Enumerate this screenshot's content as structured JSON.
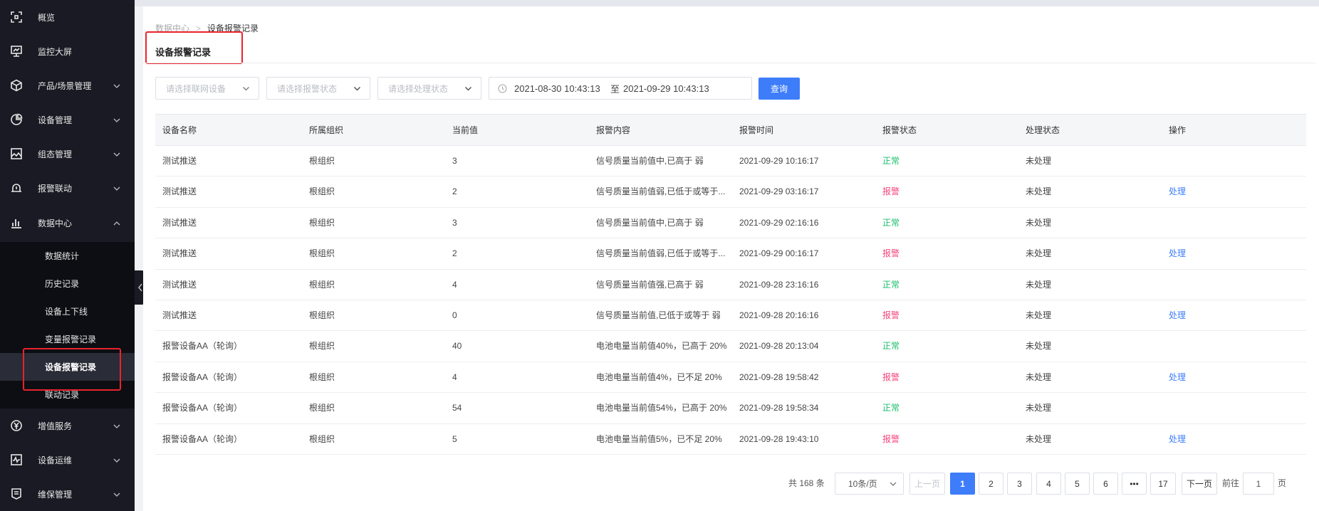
{
  "sidebar": {
    "items": [
      {
        "label": "概览",
        "icon": "overview-icon"
      },
      {
        "label": "监控大屏",
        "icon": "monitor-screen-icon"
      },
      {
        "label": "产品/场景管理",
        "icon": "cube-icon"
      },
      {
        "label": "设备管理",
        "icon": "pie-chart-icon"
      },
      {
        "label": "组态管理",
        "icon": "image-icon"
      },
      {
        "label": "报警联动",
        "icon": "alarm-icon"
      },
      {
        "label": "数据中心",
        "icon": "bar-chart-icon"
      },
      {
        "label": "增值服务",
        "icon": "yen-icon"
      },
      {
        "label": "设备运维",
        "icon": "pulse-icon"
      },
      {
        "label": "维保管理",
        "icon": "document-icon"
      }
    ],
    "submenu": [
      {
        "label": "数据统计"
      },
      {
        "label": "历史记录"
      },
      {
        "label": "设备上下线"
      },
      {
        "label": "变量报警记录"
      },
      {
        "label": "设备报警记录"
      },
      {
        "label": "联动记录"
      }
    ]
  },
  "breadcrumb": {
    "parent": "数据中心",
    "current": "设备报警记录"
  },
  "page_title": "设备报警记录",
  "filters": {
    "device_placeholder": "请选择联网设备",
    "alarm_state_placeholder": "请选择报警状态",
    "handle_state_placeholder": "请选择处理状态",
    "date_start": "2021-08-30 10:43:13",
    "date_to": "至",
    "date_end": "2021-09-29 10:43:13",
    "query_label": "查询"
  },
  "table": {
    "columns": [
      "设备名称",
      "所属组织",
      "当前值",
      "报警内容",
      "报警时间",
      "报警状态",
      "处理状态",
      "操作"
    ],
    "rows": [
      {
        "name": "测试推送",
        "org": "根组织",
        "value": "3",
        "content": "信号质量当前值中,已高于 弱",
        "time": "2021-09-29 10:16:17",
        "status": "正常",
        "handle": "未处理",
        "op": ""
      },
      {
        "name": "测试推送",
        "org": "根组织",
        "value": "2",
        "content": "信号质量当前值弱,已低于或等于...",
        "time": "2021-09-29 03:16:17",
        "status": "报警",
        "handle": "未处理",
        "op": "处理"
      },
      {
        "name": "测试推送",
        "org": "根组织",
        "value": "3",
        "content": "信号质量当前值中,已高于 弱",
        "time": "2021-09-29 02:16:16",
        "status": "正常",
        "handle": "未处理",
        "op": ""
      },
      {
        "name": "测试推送",
        "org": "根组织",
        "value": "2",
        "content": "信号质量当前值弱,已低于或等于...",
        "time": "2021-09-29 00:16:17",
        "status": "报警",
        "handle": "未处理",
        "op": "处理"
      },
      {
        "name": "测试推送",
        "org": "根组织",
        "value": "4",
        "content": "信号质量当前值强,已高于 弱",
        "time": "2021-09-28 23:16:16",
        "status": "正常",
        "handle": "未处理",
        "op": ""
      },
      {
        "name": "测试推送",
        "org": "根组织",
        "value": "0",
        "content": "信号质量当前值,已低于或等于 弱",
        "time": "2021-09-28 20:16:16",
        "status": "报警",
        "handle": "未处理",
        "op": "处理"
      },
      {
        "name": "报警设备AA（轮询）",
        "org": "根组织",
        "value": "40",
        "content": "电池电量当前值40%，已高于 20%",
        "time": "2021-09-28 20:13:04",
        "status": "正常",
        "handle": "未处理",
        "op": ""
      },
      {
        "name": "报警设备AA（轮询）",
        "org": "根组织",
        "value": "4",
        "content": "电池电量当前值4%，已不足 20%",
        "time": "2021-09-28 19:58:42",
        "status": "报警",
        "handle": "未处理",
        "op": "处理"
      },
      {
        "name": "报警设备AA（轮询）",
        "org": "根组织",
        "value": "54",
        "content": "电池电量当前值54%，已高于 20%",
        "time": "2021-09-28 19:58:34",
        "status": "正常",
        "handle": "未处理",
        "op": ""
      },
      {
        "name": "报警设备AA（轮询）",
        "org": "根组织",
        "value": "5",
        "content": "电池电量当前值5%，已不足 20%",
        "time": "2021-09-28 19:43:10",
        "status": "报警",
        "handle": "未处理",
        "op": "处理"
      }
    ]
  },
  "pagination": {
    "total_text": "共 168 条",
    "page_size": "10条/页",
    "prev_label": "上一页",
    "pages": [
      "1",
      "2",
      "3",
      "4",
      "5",
      "6",
      "•••",
      "17"
    ],
    "current_page": "1",
    "next_label": "下一页",
    "goto_label": "前往",
    "goto_value": "1",
    "page_word": "页"
  },
  "colors": {
    "sidebar_bg": "#191a23",
    "primary": "#3e7dfa",
    "status_ok": "#19be6b",
    "status_alarm": "#f5457c",
    "highlight_border": "#e8232c"
  }
}
